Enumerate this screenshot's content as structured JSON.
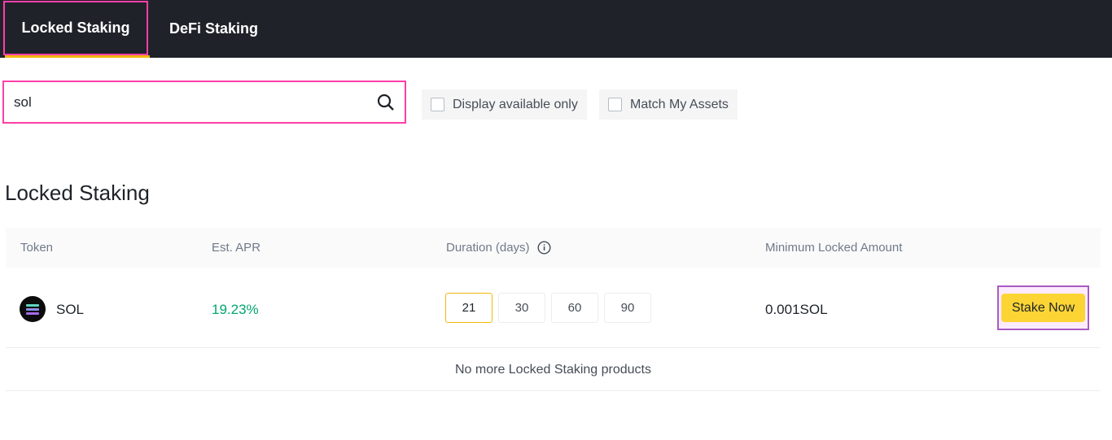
{
  "tabs": [
    {
      "label": "Locked Staking",
      "active": true
    },
    {
      "label": "DeFi Staking",
      "active": false
    }
  ],
  "search": {
    "value": "sol"
  },
  "filters": {
    "available_only": "Display available only",
    "match_assets": "Match My Assets"
  },
  "section_title": "Locked Staking",
  "table": {
    "headers": {
      "token": "Token",
      "apr": "Est. APR",
      "duration": "Duration (days)",
      "min": "Minimum Locked Amount"
    },
    "rows": [
      {
        "token": "SOL",
        "apr": "19.23%",
        "durations": [
          "21",
          "30",
          "60",
          "90"
        ],
        "selected_duration": "21",
        "min": "0.001SOL",
        "action": "Stake Now"
      }
    ],
    "footer": "No more Locked Staking products"
  },
  "colors": {
    "accent": "#fcd535",
    "apr_green": "#03a66d",
    "topbar": "#1f2229"
  }
}
